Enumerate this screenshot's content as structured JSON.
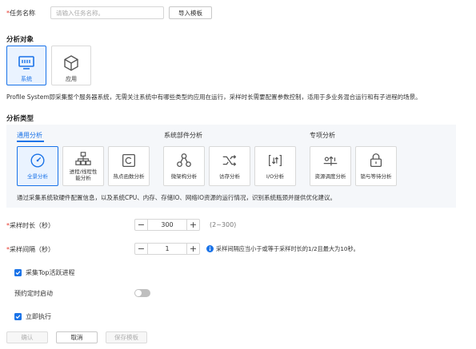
{
  "task": {
    "required_mark": "*",
    "label": "任务名称",
    "placeholder": "请输入任务名称。",
    "import_button": "导入模板"
  },
  "analysis_object": {
    "title": "分析对象",
    "options": [
      {
        "label": "系统",
        "icon": "monitor-icon",
        "selected": true
      },
      {
        "label": "应用",
        "icon": "cube-icon",
        "selected": false
      }
    ],
    "description": "Profile System即采集整个服务器系统，无需关注系统中有哪些类型的应用在运行，采样时长需要配置参数控制，适用于多业务混合运行和有子进程的场景。"
  },
  "analysis_type": {
    "title": "分析类型",
    "groups": [
      "通用分析",
      "系统部件分析",
      "专项分析"
    ],
    "cards": [
      {
        "label": "全景分析",
        "icon": "gauge-icon",
        "selected": true
      },
      {
        "label": "进程/线程性\n能分析",
        "icon": "hierarchy-icon",
        "selected": false
      },
      {
        "label": "热点函数分析",
        "icon": "code-c-icon",
        "selected": false
      },
      {
        "label": "微架构分析",
        "icon": "nodes-icon",
        "selected": false
      },
      {
        "label": "访存分析",
        "icon": "shuffle-icon",
        "selected": false
      },
      {
        "label": "I/O分析",
        "icon": "io-arrows-icon",
        "selected": false
      },
      {
        "label": "资源调度分析",
        "icon": "schedule-icon",
        "selected": false
      },
      {
        "label": "锁与等待分析",
        "icon": "lock-icon",
        "selected": false
      }
    ],
    "description": "通过采集系统软硬件配置信息，以及系统CPU、内存、存储IO、网络IO资源的运行情况，识别系统瓶颈并提供优化建议。"
  },
  "params": {
    "duration": {
      "label": "采样时长（秒）",
      "value": "300",
      "range": "(2~300)",
      "minus": "−",
      "plus": "+"
    },
    "interval": {
      "label": "采样间隔（秒）",
      "value": "1",
      "hint": "采样间隔应当小于或等于采样时长的1/2且最大为10秒。",
      "minus": "−",
      "plus": "+"
    },
    "collect_top": {
      "label": "采集Top活跃进程",
      "checked": true
    },
    "scheduled": {
      "label": "预约定时启动",
      "on": false
    },
    "run_now": {
      "label": "立即执行",
      "checked": true
    }
  },
  "footer": {
    "confirm": "确认",
    "cancel": "取消",
    "save_template": "保存模板"
  },
  "colors": {
    "accent": "#1a73e8",
    "required": "#e6392e",
    "panel": "#f5f7fa"
  }
}
